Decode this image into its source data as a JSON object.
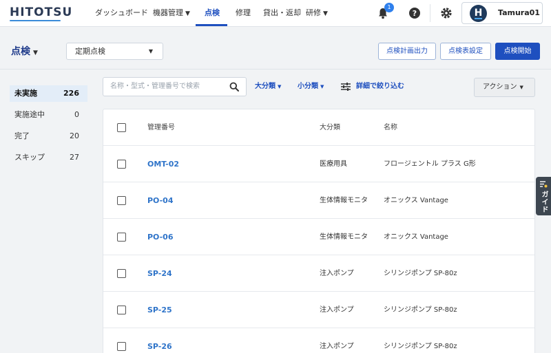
{
  "app": {
    "logo": "HITOTSU",
    "user": "Tamura01",
    "avatar_letter": "H",
    "notification_count": "1"
  },
  "nav": {
    "dashboard": "ダッシュボード",
    "equipment": "機器管理",
    "inspection": "点検",
    "repair": "修理",
    "lending": "貸出・返却",
    "training": "研修"
  },
  "page": {
    "title": "点検",
    "type_select": "定期点検",
    "btn_plan_output": "点検計画出力",
    "btn_sheet_settings": "点検表設定",
    "btn_start": "点検開始"
  },
  "statuses": [
    {
      "label": "未実施",
      "count": "226"
    },
    {
      "label": "実施途中",
      "count": "0"
    },
    {
      "label": "完了",
      "count": "20"
    },
    {
      "label": "スキップ",
      "count": "27"
    }
  ],
  "filters": {
    "search_placeholder": "名称・型式・管理番号で検索",
    "major_category": "大分類",
    "minor_category": "小分類",
    "detail_filter": "詳細で絞り込む",
    "action": "アクション"
  },
  "table": {
    "headers": {
      "id": "管理番号",
      "category": "大分類",
      "name": "名称"
    },
    "rows": [
      {
        "id": "OMT-02",
        "category": "医療用具",
        "name": "フロージェントル プラス G形"
      },
      {
        "id": "PO-04",
        "category": "生体情報モニタ",
        "name": "オニックス Vantage"
      },
      {
        "id": "PO-06",
        "category": "生体情報モニタ",
        "name": "オニックス Vantage"
      },
      {
        "id": "SP-24",
        "category": "注入ポンプ",
        "name": "シリンジポンプ SP-80z"
      },
      {
        "id": "SP-25",
        "category": "注入ポンプ",
        "name": "シリンジポンプ SP-80z"
      },
      {
        "id": "SP-26",
        "category": "注入ポンプ",
        "name": "シリンジポンプ SP-80z"
      }
    ]
  },
  "guide": {
    "label": "ガイド"
  },
  "colors": {
    "primary": "#1e4fbf",
    "link": "#2f74c9",
    "active_bg": "#e3edf8"
  }
}
